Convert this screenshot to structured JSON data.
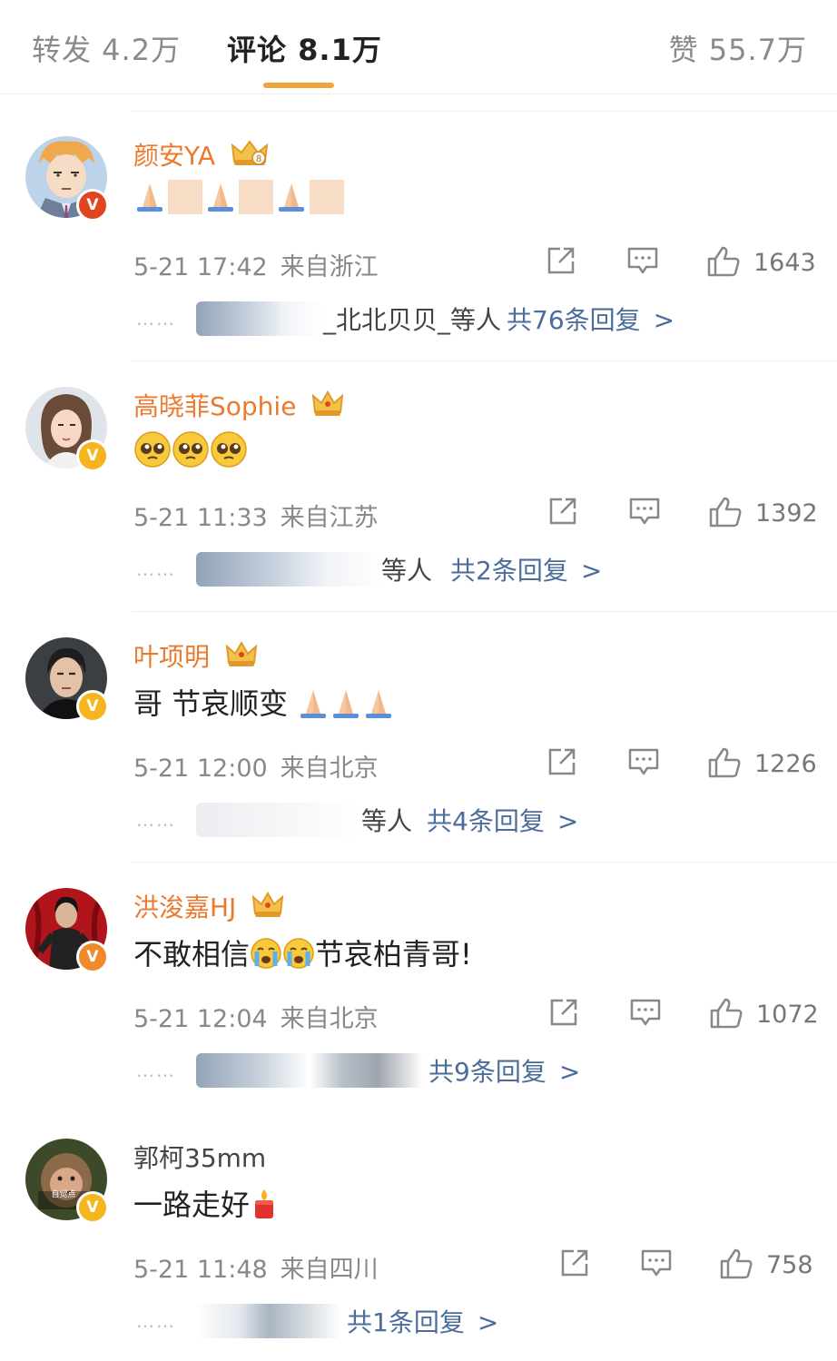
{
  "tabs": {
    "reposts": "转发 4.2万",
    "comments": "评论 8.1万",
    "likes": "赞 55.7万"
  },
  "colors": {
    "accent": "#f0a53a",
    "vip_name": "#eb7a2e",
    "link": "#4b6d9b"
  },
  "comments": [
    {
      "name": "颜安YA",
      "text_emojis": [
        "pray",
        "pray",
        "pray"
      ],
      "date": "5-21 17:42",
      "location": "来自浙江",
      "likes": "1643",
      "replies_suffix": "_北北贝贝_等人",
      "replies_link": "共76条回复"
    },
    {
      "name": "高晓菲Sophie",
      "text_emojis": [
        "pleading",
        "pleading",
        "pleading"
      ],
      "date": "5-21 11:33",
      "location": "来自江苏",
      "likes": "1392",
      "replies_suffix": "等人",
      "replies_link": "共2条回复"
    },
    {
      "name": "叶项明",
      "text": "哥 节哀顺变 ",
      "date": "5-21 12:00",
      "location": "来自北京",
      "likes": "1226",
      "replies_suffix": "等人",
      "replies_link": "共4条回复"
    },
    {
      "name": "洪浚嘉HJ",
      "text_a": "不敢相信",
      "text_b": "节哀柏青哥!",
      "date": "5-21 12:04",
      "location": "来自北京",
      "likes": "1072",
      "replies_suffix": "",
      "replies_link": "共9条回复"
    },
    {
      "name": "郭柯35mm",
      "text": "一路走好",
      "date": "5-21 11:48",
      "location": "来自四川",
      "likes": "758",
      "replies_suffix": "",
      "replies_link": "共1条回复",
      "avatar_caption": "自觉点"
    }
  ],
  "ui": {
    "dots": "……",
    "chevron": ">",
    "verified_mark": "V"
  }
}
